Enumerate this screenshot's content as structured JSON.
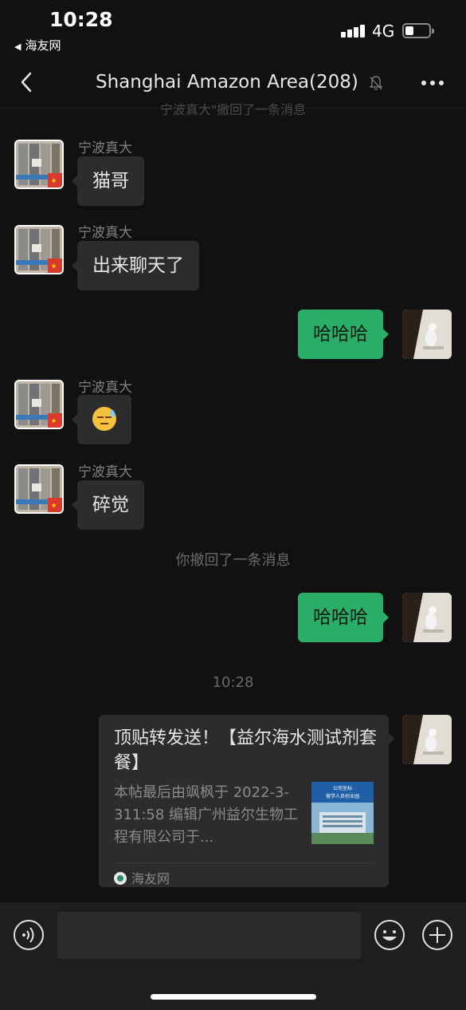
{
  "status_bar": {
    "time": "10:28",
    "back_app": "海友网",
    "network": "4G",
    "battery_level": 0.35
  },
  "header": {
    "title": "Shanghai Amazon Area(208)",
    "muted": true
  },
  "faded_notice": "宁波真大\"撤回了一条消息",
  "messages": [
    {
      "side": "left",
      "sender": "宁波真大",
      "text": "猫哥"
    },
    {
      "side": "left",
      "sender": "宁波真大",
      "text": "出来聊天了"
    },
    {
      "side": "right",
      "text": "哈哈哈"
    },
    {
      "side": "left",
      "sender": "宁波真大",
      "emoji": "sleepy-face"
    },
    {
      "side": "left",
      "sender": "宁波真大",
      "text": "碎觉"
    },
    {
      "type": "notice",
      "text": "你撤回了一条消息"
    },
    {
      "side": "right",
      "text": "哈哈哈"
    },
    {
      "type": "timestamp",
      "text": "10:28"
    },
    {
      "side": "right",
      "type": "link_card",
      "title": "顶贴转发送！【益尔海水测试剂套餐】",
      "description": "本帖最后由飒枫于 2022-3-311:58 编辑广州益尔生物工程有限公司于...",
      "thumbnail_text": [
        "公司坐标",
        "留学人员创业园"
      ],
      "source": "海友网"
    }
  ],
  "input_bar": {
    "placeholder": ""
  },
  "colors": {
    "background": "#111111",
    "bubble_in": "#2c2c2c",
    "bubble_out": "#2aae67"
  }
}
